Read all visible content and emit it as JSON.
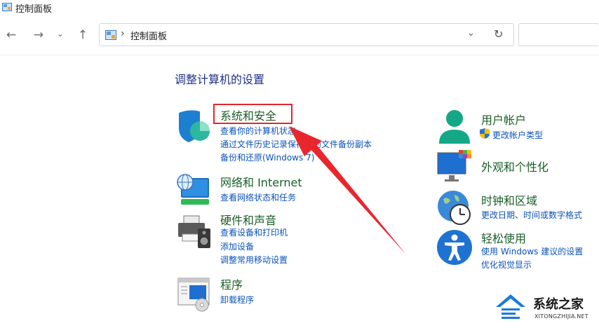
{
  "window": {
    "title": "控制面板"
  },
  "toolbar": {
    "back_glyph": "←",
    "forward_glyph": "→",
    "recent_glyph": "⌄",
    "up_glyph": "↑",
    "breadcrumb_sep": "›",
    "breadcrumb": "控制面板",
    "dropdown_glyph": "⌄",
    "refresh_glyph": "↻",
    "search_value": ""
  },
  "main": {
    "heading": "调整计算机的设置",
    "left": [
      {
        "title": "系统和安全",
        "icon": "shield-icon",
        "links": [
          "查看你的计算机状态",
          "通过文件历史记录保存你的文件备份副本",
          "备份和还原(Windows 7)"
        ]
      },
      {
        "title": "网络和 Internet",
        "icon": "network-globe-icon",
        "links": [
          "查看网络状态和任务"
        ]
      },
      {
        "title": "硬件和声音",
        "icon": "printer-speaker-icon",
        "links": [
          "查看设备和打印机",
          "添加设备",
          "调整常用移动设置"
        ]
      },
      {
        "title": "程序",
        "icon": "programs-icon",
        "links": [
          "卸载程序"
        ]
      }
    ],
    "right": [
      {
        "title": "用户帐户",
        "icon": "user-accounts-icon",
        "links": [
          "更改帐户类型"
        ]
      },
      {
        "title": "外观和个性化",
        "icon": "monitor-personalize-icon",
        "links": []
      },
      {
        "title": "时钟和区域",
        "icon": "clock-globe-icon",
        "links": [
          "更改日期、时间或数字格式"
        ]
      },
      {
        "title": "轻松使用",
        "icon": "accessibility-icon",
        "links": [
          "使用 Windows 建议的设置",
          "优化视觉显示"
        ]
      }
    ]
  },
  "watermark": {
    "text": "系统之家",
    "sub": "XITONGZHIJIA.NET"
  },
  "colors": {
    "category_title": "#1a5e26",
    "link": "#0b52b8",
    "heading": "#1e3287",
    "highlight_box": "#e0282d",
    "arrow": "#e8262e"
  }
}
